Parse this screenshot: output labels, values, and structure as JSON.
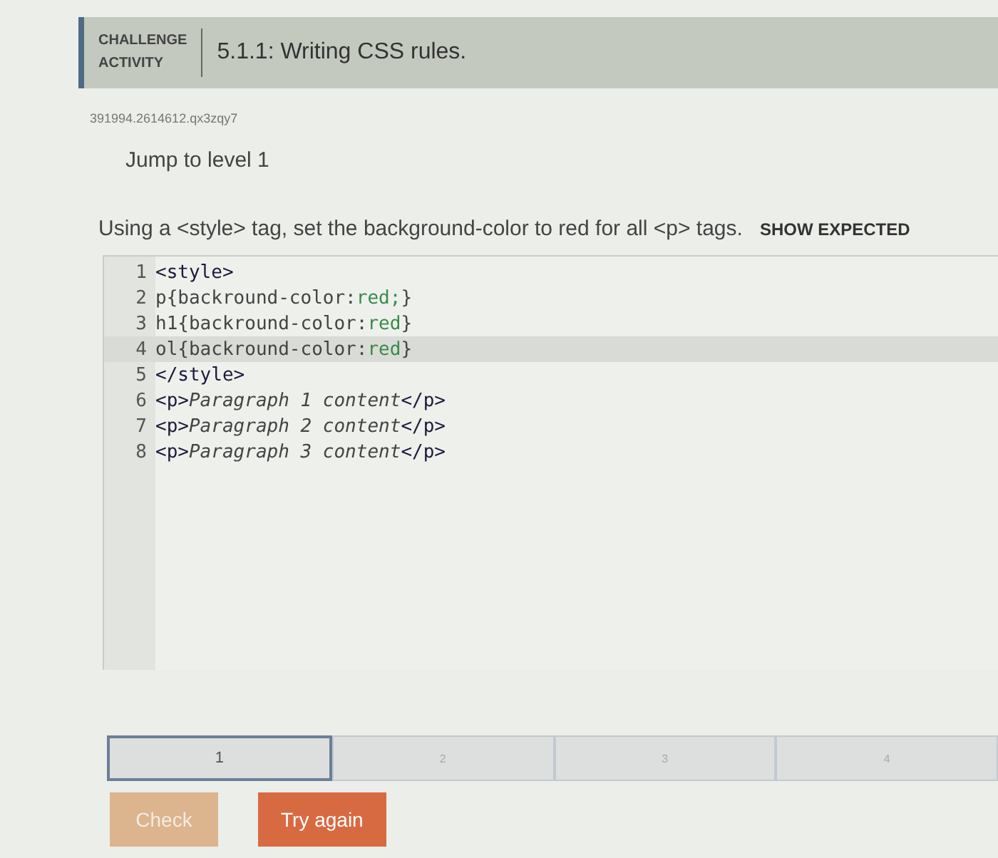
{
  "header": {
    "label_lines": [
      "CHALLENGE",
      "ACTIVITY"
    ],
    "title": "5.1.1: Writing CSS rules."
  },
  "activity_id": "391994.2614612.qx3zqy7",
  "jump_link": "Jump to level 1",
  "instructions": "Using a <style> tag, set the background-color to red for all <p> tags.",
  "show_expected": "SHOW EXPECTED",
  "editor": {
    "lines": [
      {
        "number": "1",
        "current": false,
        "segments": [
          {
            "kind": "tag",
            "text": "<style>"
          }
        ]
      },
      {
        "number": "2",
        "current": false,
        "segments": [
          {
            "kind": "plain",
            "text": "p{backround-color:"
          },
          {
            "kind": "value",
            "text": "red;"
          },
          {
            "kind": "plain",
            "text": "}"
          }
        ]
      },
      {
        "number": "3",
        "current": false,
        "segments": [
          {
            "kind": "plain",
            "text": "h1{backround-color:"
          },
          {
            "kind": "value",
            "text": "red"
          },
          {
            "kind": "plain",
            "text": "}"
          }
        ]
      },
      {
        "number": "4",
        "current": true,
        "segments": [
          {
            "kind": "plain",
            "text": "ol{backround-color:"
          },
          {
            "kind": "value",
            "text": "red"
          },
          {
            "kind": "plain",
            "text": "}"
          }
        ]
      },
      {
        "number": "5",
        "current": false,
        "segments": [
          {
            "kind": "tag",
            "text": "</style>"
          }
        ]
      },
      {
        "number": "6",
        "current": false,
        "segments": [
          {
            "kind": "tag",
            "text": "<p>"
          },
          {
            "kind": "italic",
            "text": "Paragraph 1 content"
          },
          {
            "kind": "tag",
            "text": "</p>"
          }
        ]
      },
      {
        "number": "7",
        "current": false,
        "segments": [
          {
            "kind": "tag",
            "text": "<p>"
          },
          {
            "kind": "italic",
            "text": "Paragraph 2 content"
          },
          {
            "kind": "tag",
            "text": "</p>"
          }
        ]
      },
      {
        "number": "8",
        "current": false,
        "segments": [
          {
            "kind": "tag",
            "text": "<p>"
          },
          {
            "kind": "italic",
            "text": "Paragraph 3 content"
          },
          {
            "kind": "tag",
            "text": "</p>"
          }
        ]
      }
    ]
  },
  "levels": [
    {
      "label": "1",
      "selected": true
    },
    {
      "label": "2",
      "selected": false
    },
    {
      "label": "3",
      "selected": false
    },
    {
      "label": "4",
      "selected": false
    }
  ],
  "buttons": [
    {
      "label": "Check",
      "disabled": true
    },
    {
      "label": "Try again",
      "disabled": false
    }
  ]
}
